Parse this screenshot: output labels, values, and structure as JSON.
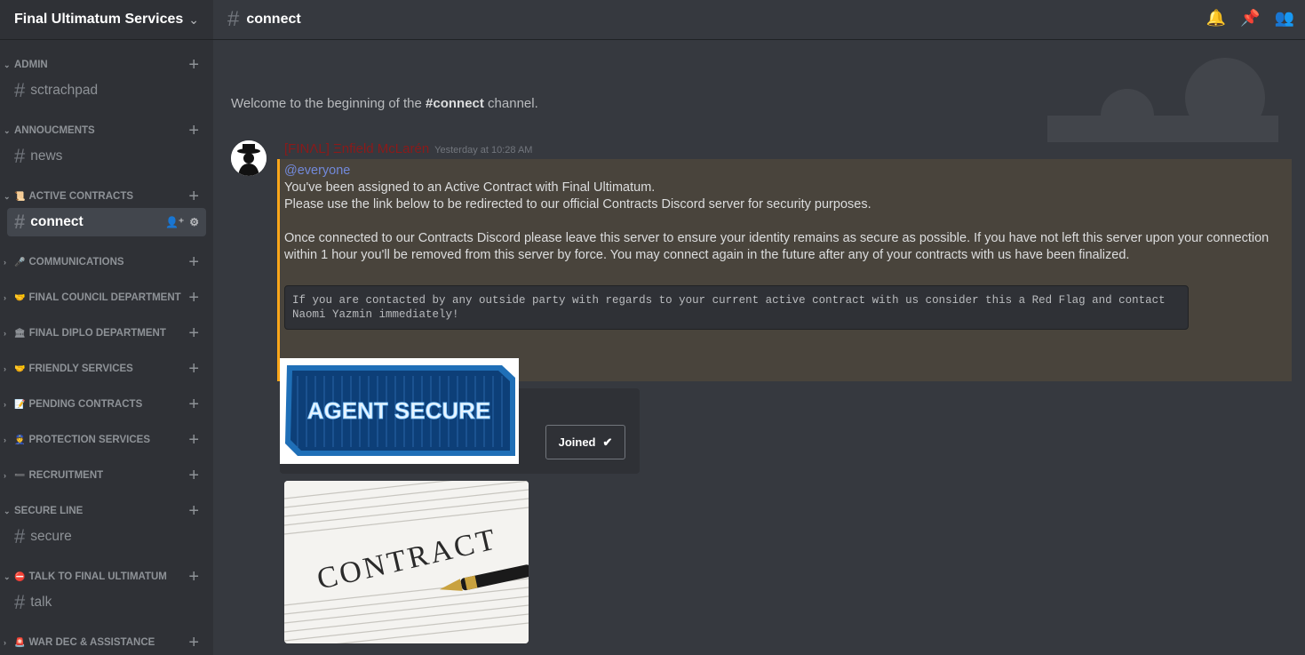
{
  "server": {
    "name": "Final Ultimatum Services"
  },
  "sidebar": {
    "categories": [
      {
        "label": "ADMIN",
        "emoji": ""
      },
      {
        "label": "ANNOUCMENTS",
        "emoji": ""
      },
      {
        "label": "ACTIVE CONTRACTS",
        "emoji": "📜"
      },
      {
        "label": "COMMUNICATIONS",
        "emoji": "🎤"
      },
      {
        "label": "FINAL COUNCIL DEPARTMENT",
        "emoji": "🤝"
      },
      {
        "label": "FINAL DIPLO DEPARTMENT",
        "emoji": "🏛"
      },
      {
        "label": "FRIENDLY SERVICES",
        "emoji": "🤝"
      },
      {
        "label": "PENDING CONTRACTS",
        "emoji": "📝"
      },
      {
        "label": "PROTECTION SERVICES",
        "emoji": "👮"
      },
      {
        "label": "RECRUITMENT",
        "emoji": "➖"
      },
      {
        "label": "SECURE LINE",
        "emoji": ""
      },
      {
        "label": "TALK TO FINAL ULTIMATUM",
        "emoji": "⛔"
      },
      {
        "label": "WAR DEC & ASSISTANCE",
        "emoji": "🚨"
      }
    ],
    "channels": [
      {
        "label": "sctrachpad"
      },
      {
        "label": "news"
      },
      {
        "label": "connect"
      },
      {
        "label": "secure"
      },
      {
        "label": "talk"
      }
    ]
  },
  "topbar": {
    "channel": "connect"
  },
  "chat": {
    "welcome_prefix": "Welcome to the beginning of the ",
    "welcome_channel": "#connect",
    "welcome_suffix": " channel.",
    "message": {
      "author": "[FINΛL] Ξnfield McLarén",
      "timestamp": "Yesterday at 10:28 AM",
      "mention": "@everyone",
      "line1": "You've been assigned to an Active Contract with Final Ultimatum.",
      "line2": "Please use the link below to be redirected to our official Contracts Discord server for security purposes.",
      "line3": "Once connected to our Contracts Discord please leave this server to ensure your identity remains as secure as possible. If you have not left this server upon your connection within 1 hour you'll be removed from this server by force. You may connect again in the future after any of your contracts with us have been finalized.",
      "code": "If you are contacted by any outside party with regards to your current active contract with us consider this a Red Flag and contact Naomi Yazmin immediately!"
    },
    "invite": {
      "image_text": "AGENT SECURE",
      "button": "Joined"
    },
    "contract_image_text": "CONTRACT"
  }
}
